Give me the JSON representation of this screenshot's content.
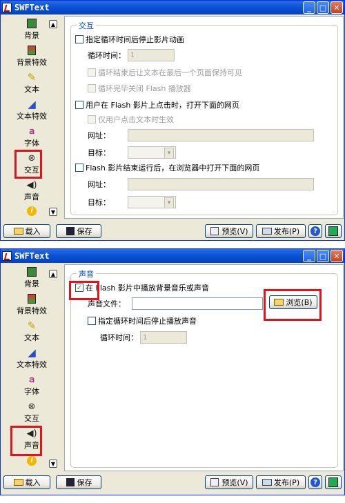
{
  "window_title": "SWFText",
  "title_buttons": {
    "minimize": "_",
    "maximize": "□",
    "close": "✕"
  },
  "sidebar": {
    "items": [
      {
        "label": "背景",
        "icon": "background-icon"
      },
      {
        "label": "背景特效",
        "icon": "background-effect-icon"
      },
      {
        "label": "文本",
        "icon": "text-icon"
      },
      {
        "label": "文本特效",
        "icon": "text-effect-icon"
      },
      {
        "label": "字体",
        "icon": "font-icon"
      },
      {
        "label": "交互",
        "icon": "interact-icon"
      },
      {
        "label": "声音",
        "icon": "sound-icon"
      }
    ],
    "scroll_up": "▲",
    "scroll_down": "▼"
  },
  "panel1": {
    "group_title": "交互",
    "stop_loop_label": "指定循环时间后停止影片动画",
    "loop_time_label": "循环时间：",
    "loop_time_value": "1",
    "keep_visible_label": "循环结束后让文本在最后一个页面保持可见",
    "close_player_label": "循环完毕关闭 Flash 播放器",
    "click_open_label": "用户在 Flash 影片上点击时，打开下面的网页",
    "only_text_label": "仅用户点击文本时生效",
    "url_label": "网址：",
    "target_label": "目标：",
    "end_open_label": "Flash 影片结束运行后，在浏览器中打开下面的网页",
    "url2_label": "网址：",
    "target2_label": "目标："
  },
  "panel2": {
    "group_title": "声音",
    "play_sound_label": "在 Flash 影片中播放背景音乐或声音",
    "sound_file_label": "声音文件：",
    "browse_label": "浏览(B)",
    "stop_sound_label": "指定循环时间后停止播放声音",
    "loop_time_label": "循环时间：",
    "loop_time_value": "1"
  },
  "bottom": {
    "load_label": "载入",
    "save_label": "保存",
    "preview_label": "预览(V)",
    "publish_label": "发布(P)"
  }
}
